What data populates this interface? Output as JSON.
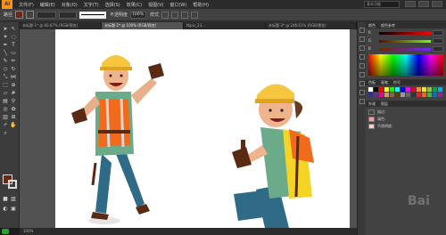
{
  "app": {
    "logo": "Ai"
  },
  "menu": [
    "文件(F)",
    "编辑(E)",
    "对象(O)",
    "文字(T)",
    "选择(S)",
    "效果(C)",
    "视图(V)",
    "窗口(W)",
    "帮助(H)"
  ],
  "search_placeholder": "基本功能",
  "control_bar": {
    "label": "路径",
    "opacity_label": "不透明度",
    "opacity_value": "100%",
    "style_label": "样式"
  },
  "tabs": [
    {
      "label": "未标题-1* @ 66.67% (RGB/预览)",
      "active": false
    },
    {
      "label": "未标题-2* @ 100% (RGB/预览)",
      "active": true
    },
    {
      "label": "Nipic_23...",
      "active": false
    },
    {
      "label": "未标题-3* @ 246.61% (RGB/预览)",
      "active": false
    }
  ],
  "status": "100%",
  "colors": {
    "fill": "#6b2a15",
    "accent_orange": "#f7941d",
    "canvas_bg": "#525252",
    "artboard": "#ffffff"
  },
  "icons": [
    "selection-tool-icon",
    "direct-selection-icon",
    "magic-wand-icon",
    "lasso-icon",
    "pen-icon",
    "type-icon",
    "line-icon",
    "rectangle-icon",
    "paintbrush-icon",
    "pencil-icon",
    "eraser-icon",
    "rotate-icon",
    "scale-icon",
    "width-icon",
    "free-transform-icon",
    "shape-builder-icon",
    "perspective-icon",
    "mesh-icon",
    "gradient-icon",
    "eyedropper-icon",
    "blend-icon",
    "symbol-icon",
    "graph-icon",
    "artboard-icon",
    "slice-icon",
    "hand-icon",
    "zoom-icon"
  ],
  "panels": {
    "color_head": [
      "颜色",
      "颜色参考"
    ],
    "swatch_head": [
      "色板",
      "画笔",
      "符号"
    ],
    "appearance_head": [
      "外观",
      "图层"
    ],
    "appearance_rows": [
      "描边:",
      "填色:",
      "不透明度:"
    ]
  }
}
